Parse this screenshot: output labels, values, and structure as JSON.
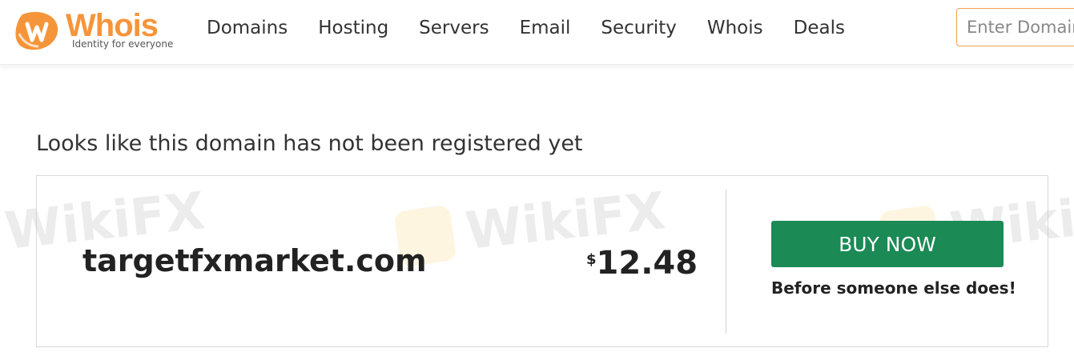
{
  "brand": {
    "name": "Whois",
    "tagline": "Identity for everyone",
    "accent_color": "#f5953a"
  },
  "nav": {
    "items": [
      {
        "label": "Domains"
      },
      {
        "label": "Hosting"
      },
      {
        "label": "Servers"
      },
      {
        "label": "Email"
      },
      {
        "label": "Security"
      },
      {
        "label": "Whois"
      },
      {
        "label": "Deals"
      }
    ]
  },
  "search": {
    "placeholder": "Enter Domain",
    "value": ""
  },
  "main": {
    "headline": "Looks like this domain has not been registered yet",
    "result": {
      "domain": "targetfxmarket.com",
      "currency_symbol": "$",
      "price": "12.48",
      "buy_label": "BUY NOW",
      "buy_note": "Before someone else does!",
      "buy_color": "#1b8a55"
    }
  },
  "watermark": {
    "text": "WikiFX"
  }
}
